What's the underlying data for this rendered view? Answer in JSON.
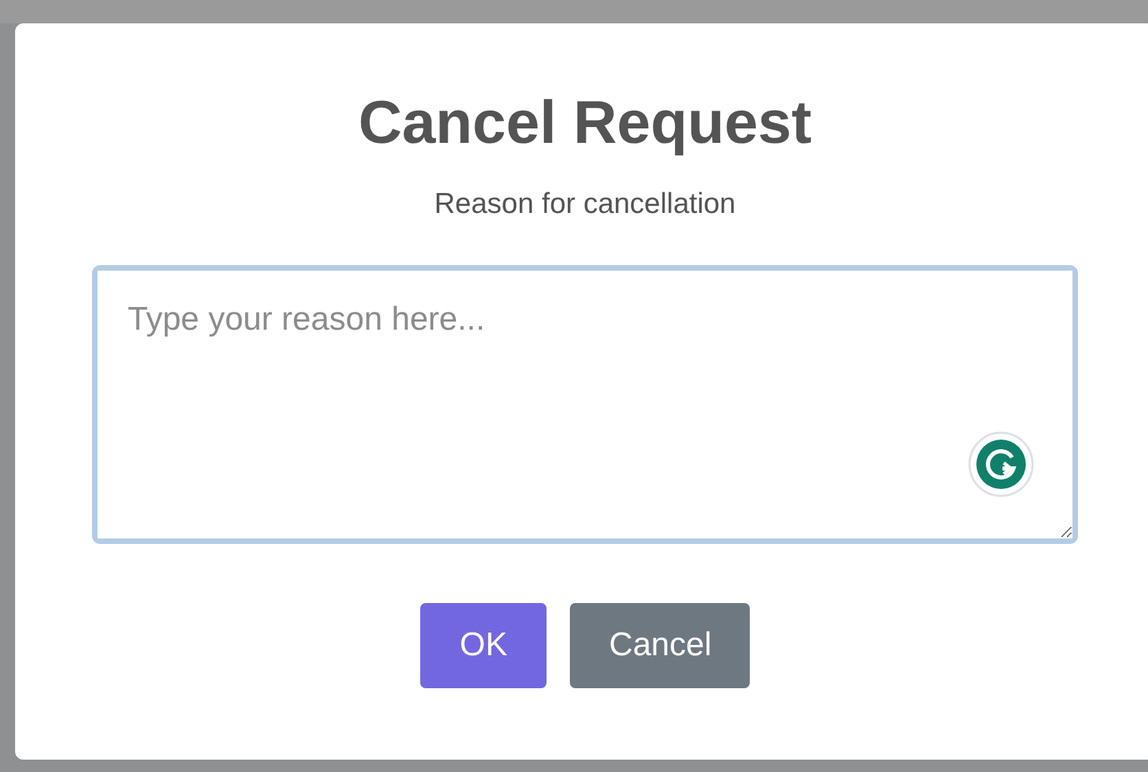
{
  "dialog": {
    "title": "Cancel Request",
    "label": "Reason for cancellation",
    "reason_field": {
      "placeholder": "Type your reason here..."
    },
    "buttons": [
      {
        "label": "OK",
        "kind": "primary"
      },
      {
        "label": "Cancel",
        "kind": "secondary"
      }
    ]
  }
}
